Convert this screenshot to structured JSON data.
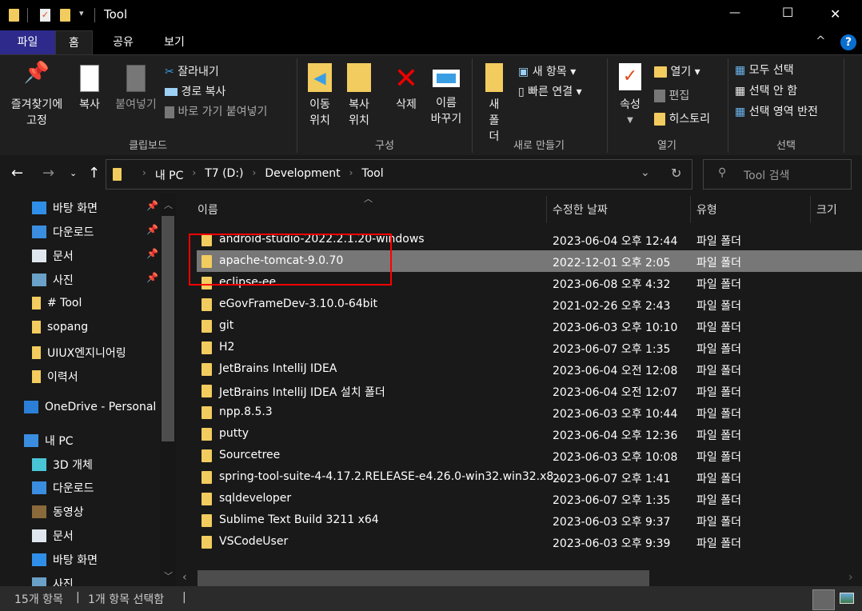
{
  "window": {
    "title": "Tool",
    "minimize": "—",
    "maximize": "☐",
    "close": "✕",
    "qat_dropdown": "▾"
  },
  "tabs": [
    {
      "label": "파일"
    },
    {
      "label": "홈"
    },
    {
      "label": "공유"
    },
    {
      "label": "보기"
    }
  ],
  "ribbon": {
    "collapse": "^",
    "help": "?",
    "clipboard": {
      "label": "클립보드",
      "pin": "즐겨찾기에 고정",
      "copy": "복사",
      "paste": "붙여넣기",
      "cut": "잘라내기",
      "copy_path": "경로 복사",
      "paste_shortcut": "바로 가기 붙여넣기"
    },
    "organize": {
      "label": "구성",
      "move_to": "이동 위치",
      "copy_to": "복사 위치",
      "delete": "삭제",
      "rename": "이름 바꾸기"
    },
    "new": {
      "label": "새로 만들기",
      "new_folder": "새 폴더",
      "new_item": "새 항목",
      "easy_access": "빠른 연결"
    },
    "open": {
      "label": "열기",
      "properties": "속성",
      "open": "열기",
      "edit": "편집",
      "history": "히스토리"
    },
    "select": {
      "label": "선택",
      "select_all": "모두 선택",
      "select_none": "선택 안 함",
      "invert": "선택 영역 반전"
    }
  },
  "address": {
    "crumbs": [
      "내 PC",
      "T7 (D:)",
      "Development",
      "Tool"
    ],
    "search_placeholder": "Tool 검색"
  },
  "nav": [
    {
      "label": "바탕 화면",
      "pinned": true,
      "icon": "desktop-icon",
      "color": "#2f8fe8"
    },
    {
      "label": "다운로드",
      "pinned": true,
      "icon": "download-icon",
      "color": "#3b8de0"
    },
    {
      "label": "문서",
      "pinned": true,
      "icon": "document-icon",
      "color": "#dfe6ee"
    },
    {
      "label": "사진",
      "pinned": true,
      "icon": "pictures-icon",
      "color": "#6aa1c8"
    },
    {
      "label": "# Tool",
      "pinned": false,
      "icon": "folder-icon",
      "color": "#f2cc5e"
    },
    {
      "label": "sopang",
      "pinned": false,
      "icon": "folder-icon",
      "color": "#f2cc5e"
    },
    {
      "label": "UIUX엔지니어링",
      "pinned": false,
      "icon": "folder-icon",
      "color": "#f2cc5e"
    },
    {
      "label": "이력서",
      "pinned": false,
      "icon": "folder-icon",
      "color": "#f2cc5e"
    },
    {
      "label": "OneDrive - Personal",
      "pinned": false,
      "icon": "cloud-icon",
      "color": "#2c7fd6",
      "indent": -10
    },
    {
      "label": "내 PC",
      "pinned": false,
      "icon": "computer-icon",
      "color": "#3b8de0",
      "indent": -10
    },
    {
      "label": "3D 개체",
      "pinned": false,
      "icon": "cube-icon",
      "color": "#49c6d6"
    },
    {
      "label": "다운로드",
      "pinned": false,
      "icon": "download-icon",
      "color": "#3b8de0"
    },
    {
      "label": "동영상",
      "pinned": false,
      "icon": "video-icon",
      "color": "#8a6a3a"
    },
    {
      "label": "문서",
      "pinned": false,
      "icon": "document-icon",
      "color": "#dfe6ee"
    },
    {
      "label": "바탕 화면",
      "pinned": false,
      "icon": "desktop-icon",
      "color": "#2f8fe8"
    },
    {
      "label": "사진",
      "pinned": false,
      "icon": "pictures-icon",
      "color": "#6aa1c8"
    }
  ],
  "columns": {
    "name": "이름",
    "date": "수정한 날짜",
    "type": "유형",
    "size": "크기"
  },
  "files": [
    {
      "name": "android-studio-2022.2.1.20-windows",
      "date": "2023-06-04 오후 12:44",
      "type": "파일 폴더"
    },
    {
      "name": "apache-tomcat-9.0.70",
      "date": "2022-12-01 오후 2:05",
      "type": "파일 폴더",
      "selected": true
    },
    {
      "name": "eclipse-ee",
      "date": "2023-06-08 오후 4:32",
      "type": "파일 폴더"
    },
    {
      "name": "eGovFrameDev-3.10.0-64bit",
      "date": "2021-02-26 오후 2:43",
      "type": "파일 폴더"
    },
    {
      "name": "git",
      "date": "2023-06-03 오후 10:10",
      "type": "파일 폴더"
    },
    {
      "name": "H2",
      "date": "2023-06-07 오후 1:35",
      "type": "파일 폴더"
    },
    {
      "name": "JetBrains IntelliJ IDEA",
      "date": "2023-06-04 오전 12:08",
      "type": "파일 폴더"
    },
    {
      "name": "JetBrains IntelliJ IDEA 설치 폴더",
      "date": "2023-06-04 오전 12:07",
      "type": "파일 폴더"
    },
    {
      "name": "npp.8.5.3",
      "date": "2023-06-03 오후 10:44",
      "type": "파일 폴더"
    },
    {
      "name": "putty",
      "date": "2023-06-04 오후 12:36",
      "type": "파일 폴더"
    },
    {
      "name": "Sourcetree",
      "date": "2023-06-03 오후 10:08",
      "type": "파일 폴더"
    },
    {
      "name": "spring-tool-suite-4-4.17.2.RELEASE-e4.26.0-win32.win32.x8...",
      "date": "2023-06-07 오후 1:41",
      "type": "파일 폴더"
    },
    {
      "name": "sqldeveloper",
      "date": "2023-06-07 오후 1:35",
      "type": "파일 폴더"
    },
    {
      "name": "Sublime Text Build 3211 x64",
      "date": "2023-06-03 오후 9:37",
      "type": "파일 폴더"
    },
    {
      "name": "VSCodeUser",
      "date": "2023-06-03 오후 9:39",
      "type": "파일 폴더"
    }
  ],
  "status": {
    "count": "15개 항목",
    "selected": "1개 항목 선택함"
  },
  "colors": {
    "file_tab": "#2d2a8c",
    "highlight": "#ff0000",
    "selected_row": "#777777",
    "folder": "#f2cc5e"
  }
}
